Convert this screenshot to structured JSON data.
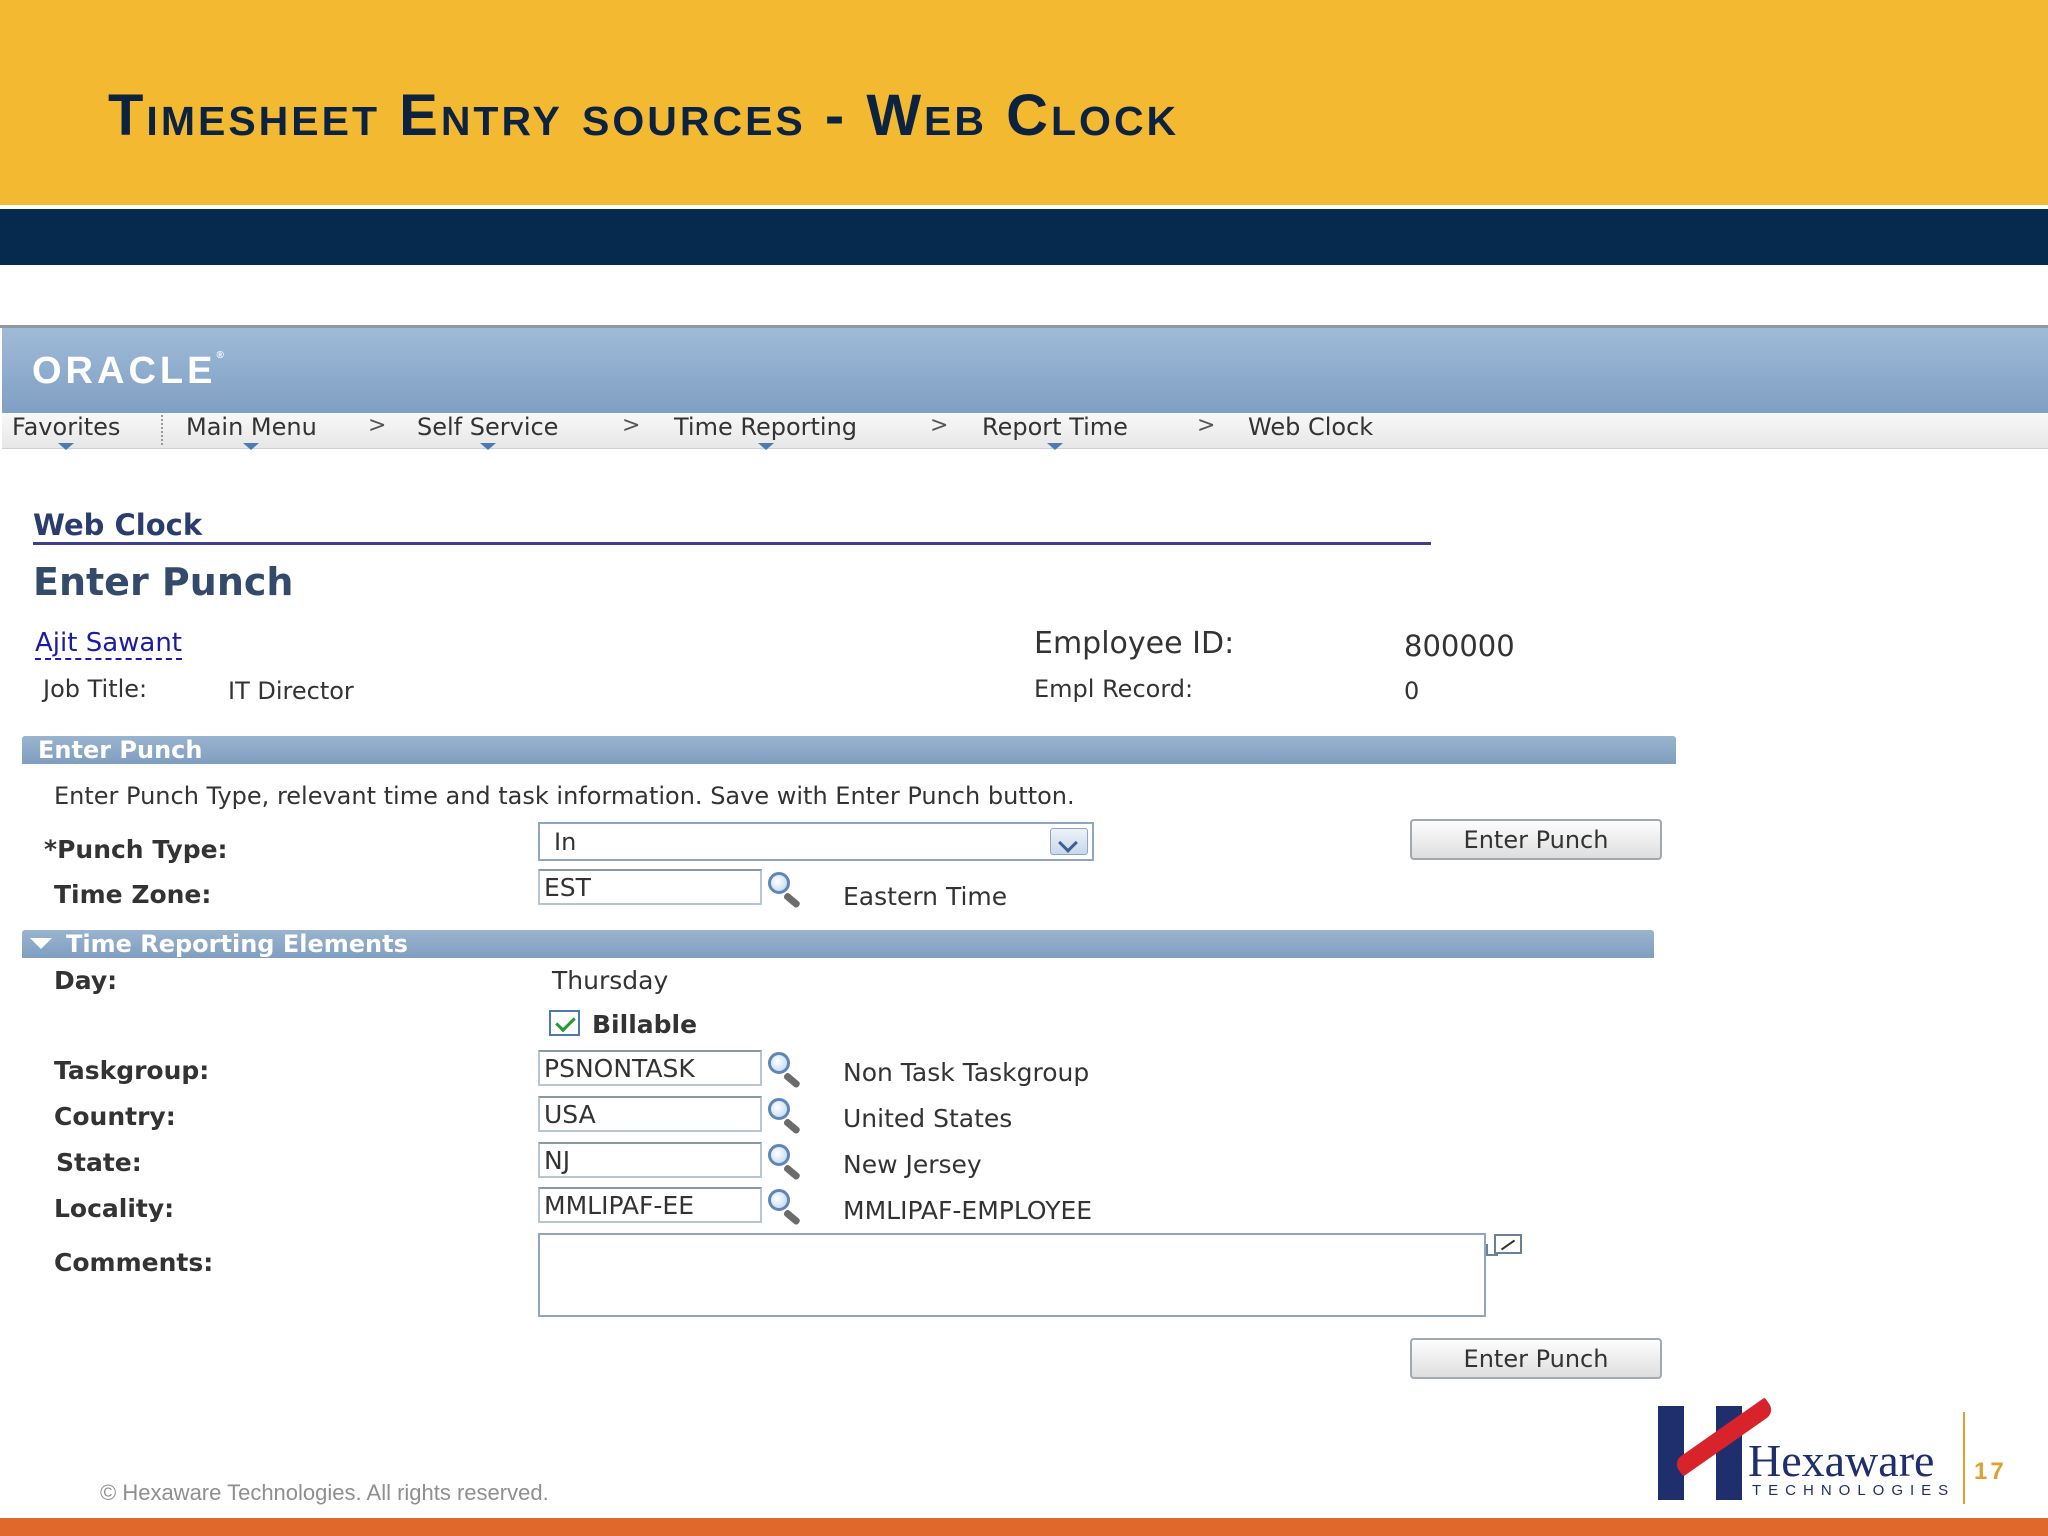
{
  "slide": {
    "title": "Timesheet Entry sources - Web Clock",
    "copyright": "© Hexaware Technologies. All rights reserved.",
    "page_number": "17",
    "logo_word": "Hexaware",
    "logo_sub": "TECHNOLOGIES"
  },
  "oracle": {
    "logo": "ORACLE",
    "trademark": "®"
  },
  "nav": {
    "items": [
      "Favorites",
      "Main Menu",
      "Self Service",
      "Time Reporting",
      "Report Time",
      "Web Clock"
    ],
    "separator": ">"
  },
  "page": {
    "breadcrumb": "Web Clock",
    "title": "Enter Punch"
  },
  "employee": {
    "name": "Ajit Sawant",
    "job_title_label": "Job Title:",
    "job_title": "IT Director",
    "id_label": "Employee ID:",
    "id": "800000",
    "record_label": "Empl Record:",
    "record": "0"
  },
  "enter_punch": {
    "section_title": "Enter Punch",
    "instructions": "Enter Punch Type, relevant time and task information. Save with Enter Punch button.",
    "punch_type_label": "*Punch Type:",
    "punch_type_value": "In",
    "time_zone_label": "Time Zone:",
    "time_zone_value": "EST",
    "time_zone_desc": "Eastern Time",
    "button_label": "Enter Punch"
  },
  "tre": {
    "section_title": "Time Reporting Elements",
    "day_label": "Day:",
    "day_value": "Thursday",
    "billable_label": "Billable",
    "billable_checked": true,
    "taskgroup_label": "Taskgroup:",
    "taskgroup_value": "PSNONTASK",
    "taskgroup_desc": "Non Task Taskgroup",
    "country_label": "Country:",
    "country_value": "USA",
    "country_desc": "United States",
    "state_label": "State:",
    "state_value": "NJ",
    "state_desc": "New Jersey",
    "locality_label": "Locality:",
    "locality_value": "MMLIPAF-EE",
    "locality_desc": "MMLIPAF-EMPLOYEE",
    "comments_label": "Comments:",
    "comments_value": "",
    "bottom_button_label": "Enter Punch"
  },
  "colors": {
    "slide_band": "#f3b930",
    "slide_navy": "#052a4d",
    "footer": "#e0682a",
    "link": "#1a1aa6"
  }
}
